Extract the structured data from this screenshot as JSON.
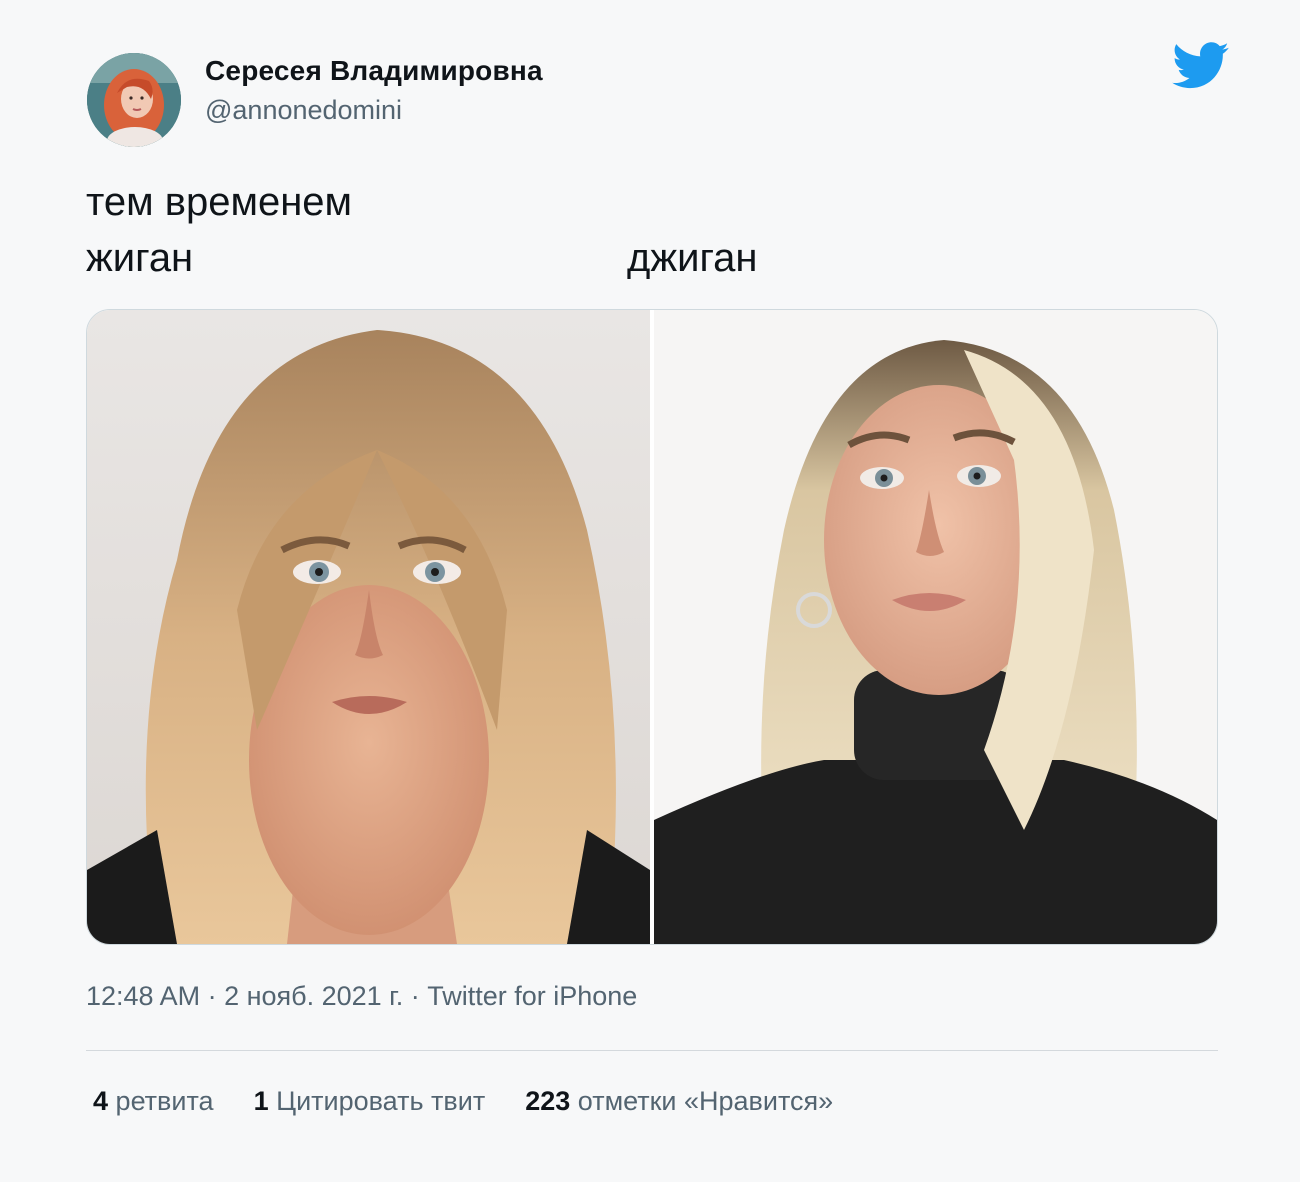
{
  "author": {
    "display_name": "Сересея Владимировна",
    "handle": "@annonedomini",
    "avatar_icon": "profile-photo",
    "brand_icon": "twitter-bird-icon",
    "brand_color": "#1d9bf0"
  },
  "tweet": {
    "line1": "тем временем",
    "label_left": "жиган",
    "label_right": "джиган"
  },
  "media": {
    "left_photo_icon": "portrait-photo",
    "right_photo_icon": "portrait-photo"
  },
  "meta": {
    "text": "12:48 AM · 2 нояб. 2021 г. · Twitter for iPhone"
  },
  "stats": [
    {
      "count": "4",
      "label": "ретвита"
    },
    {
      "count": "1",
      "label": "Цитировать твит"
    },
    {
      "count": "223",
      "label": "отметки «Нравится»"
    }
  ]
}
